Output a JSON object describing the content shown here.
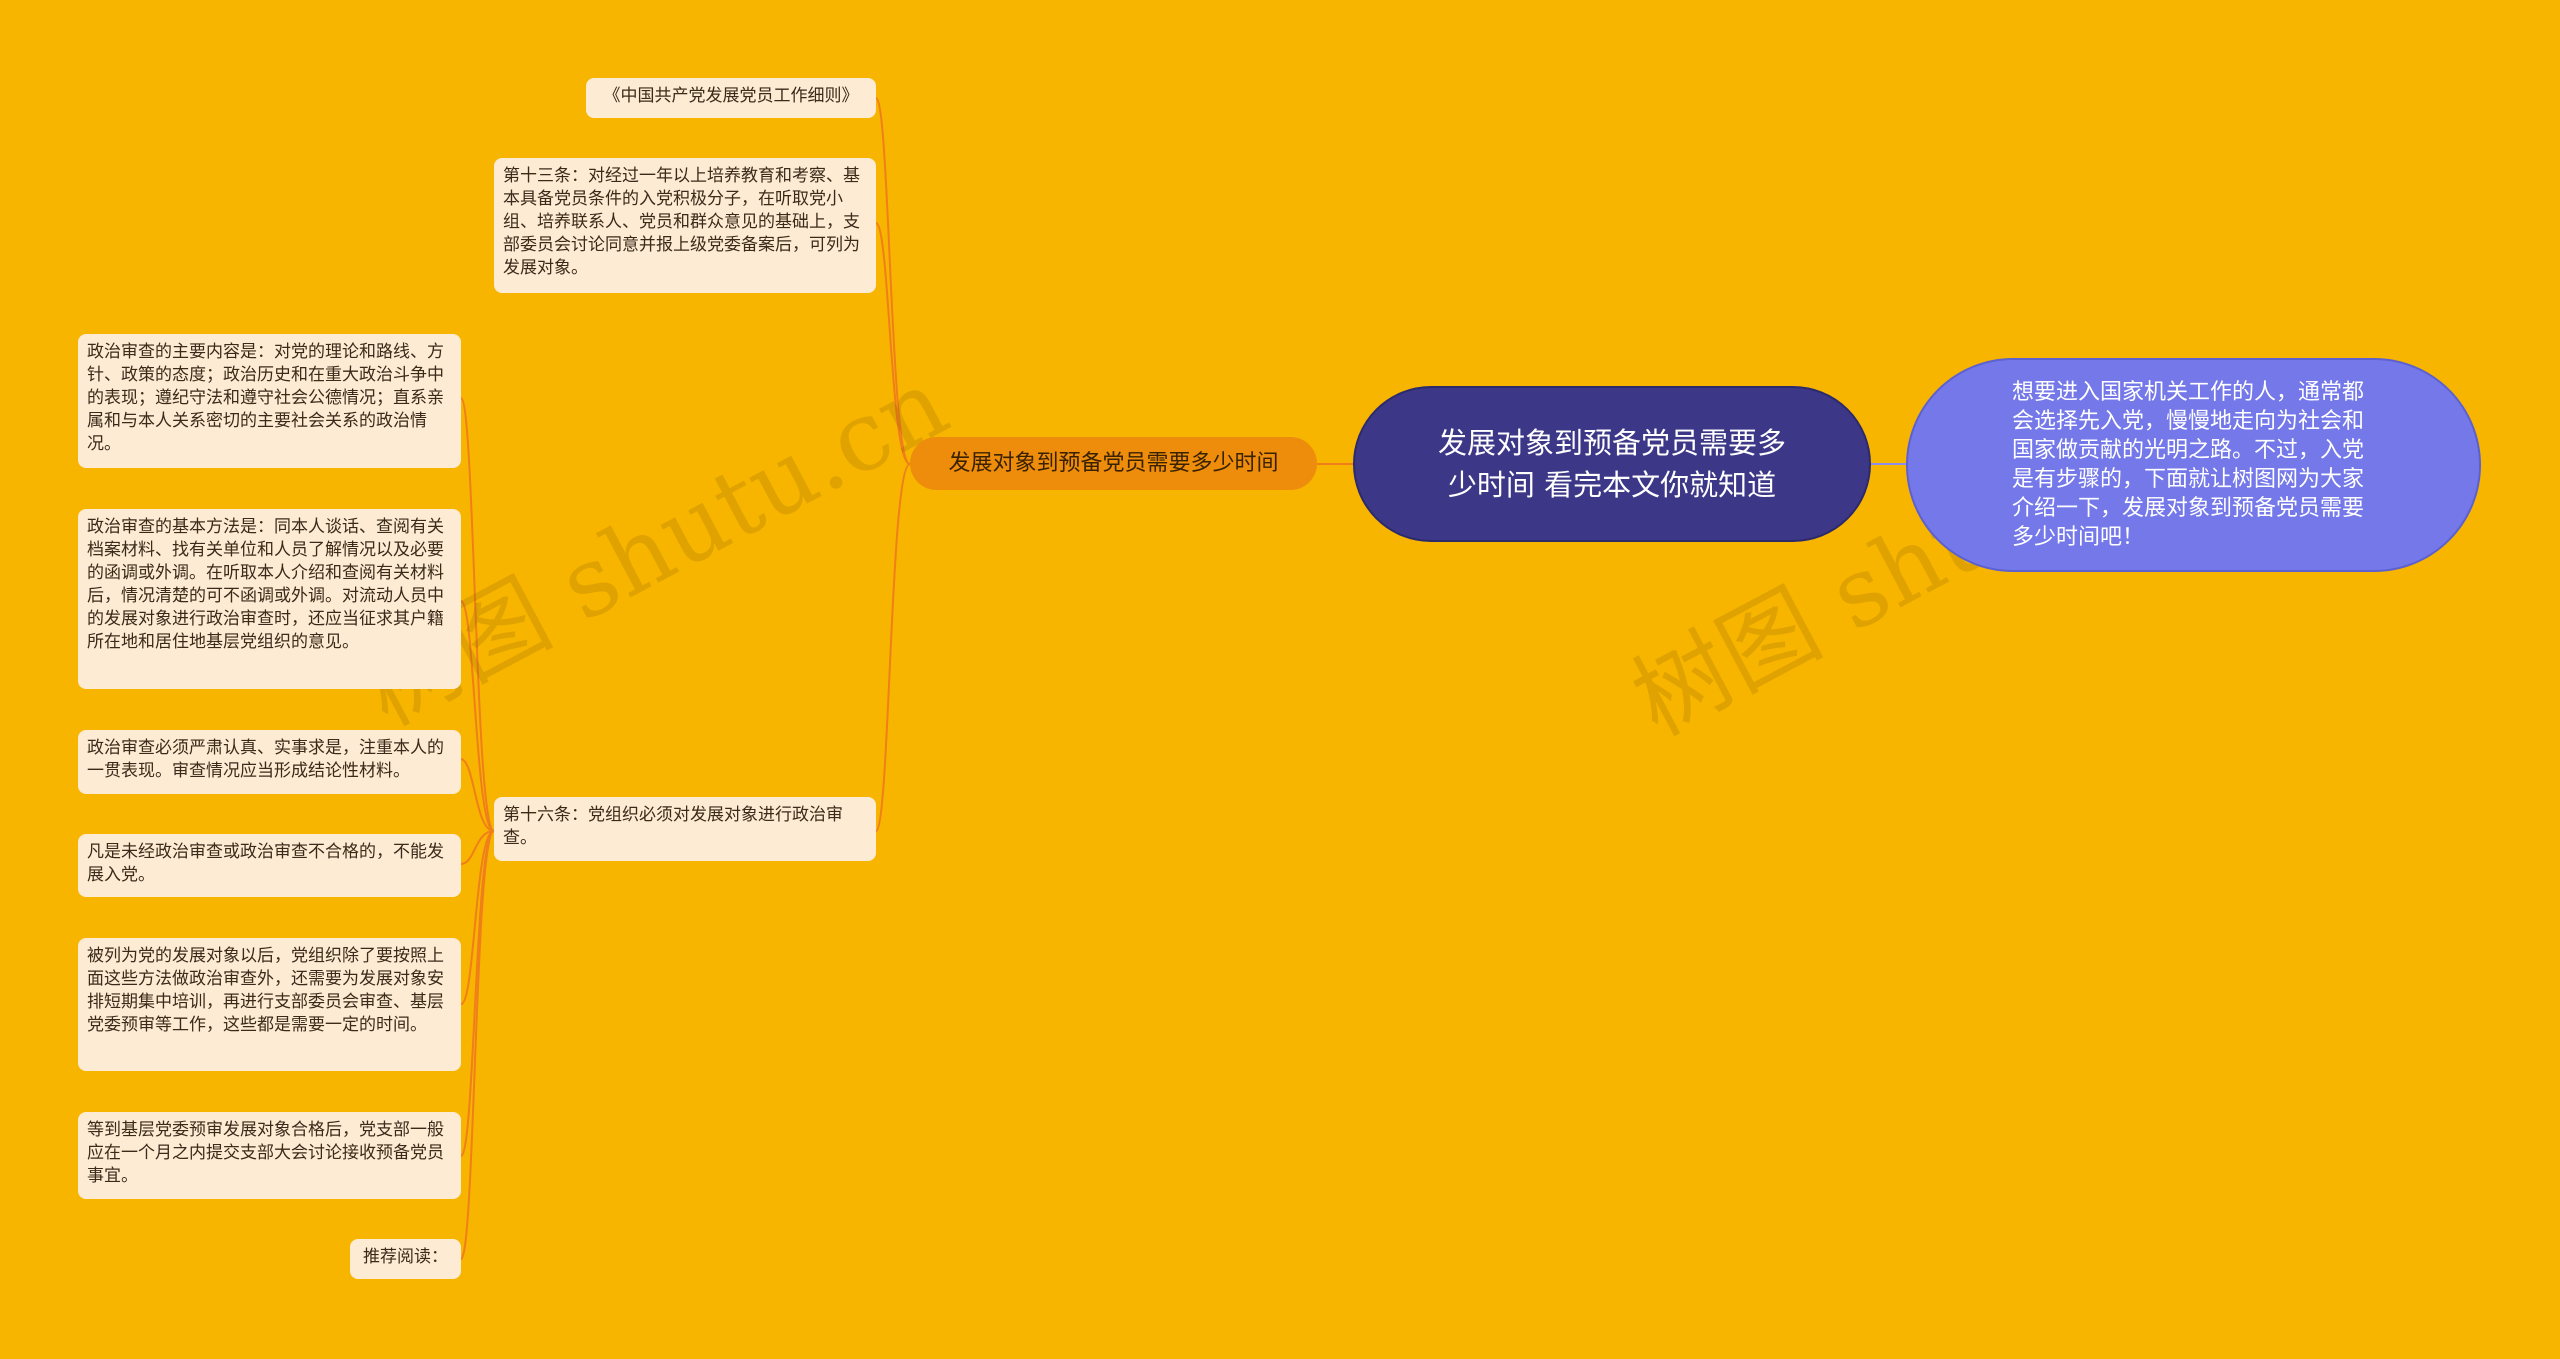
{
  "center": {
    "title": "发展对象到预备党员需要多少时间 看完本文你就知道"
  },
  "intro": {
    "text": "想要进入国家机关工作的人，通常都会选择先入党，慢慢地走向为社会和国家做贡献的光明之路。不过，入党是有步骤的，下面就让树图网为大家介绍一下，发展对象到预备党员需要多少时间吧！"
  },
  "branch": {
    "label": "发展对象到预备党员需要多少时间"
  },
  "level2": [
    {
      "text": "《中国共产党发展党员工作细则》"
    },
    {
      "text": "第十三条：对经过一年以上培养教育和考察、基本具备党员条件的入党积极分子，在听取党小组、培养联系人、党员和群众意见的基础上，支部委员会讨论同意并报上级党委备案后，可列为发展对象。"
    },
    {
      "text": "第十六条：党组织必须对发展对象进行政治审查。"
    }
  ],
  "level3": [
    {
      "text": "政治审查的主要内容是：对党的理论和路线、方针、政策的态度；政治历史和在重大政治斗争中的表现；遵纪守法和遵守社会公德情况；直系亲属和与本人关系密切的主要社会关系的政治情况。"
    },
    {
      "text": "政治审查的基本方法是：同本人谈话、查阅有关档案材料、找有关单位和人员了解情况以及必要的函调或外调。在听取本人介绍和查阅有关材料后，情况清楚的可不函调或外调。对流动人员中的发展对象进行政治审查时，还应当征求其户籍所在地和居住地基层党组织的意见。"
    },
    {
      "text": "政治审查必须严肃认真、实事求是，注重本人的一贯表现。审查情况应当形成结论性材料。"
    },
    {
      "text": "凡是未经政治审查或政治审查不合格的，不能发展入党。"
    },
    {
      "text": "被列为党的发展对象以后，党组织除了要按照上面这些方法做政治审查外，还需要为发展对象安排短期集中培训，再进行支部委员会审查、基层党委预审等工作，这些都是需要一定的时间。"
    },
    {
      "text": "等到基层党委预审发展对象合格后，党支部一般应在一个月之内提交支部大会讨论接收预备党员事宜。"
    },
    {
      "text": "推荐阅读："
    }
  ],
  "watermark": {
    "text": "树图 shutu.cn"
  },
  "colors": {
    "background": "#F7B500",
    "center": "#3C3787",
    "intro": "#7478E8",
    "branch": "#EE8C0C",
    "leaf": "#FDEBD3",
    "connector": "#F07F1A"
  }
}
